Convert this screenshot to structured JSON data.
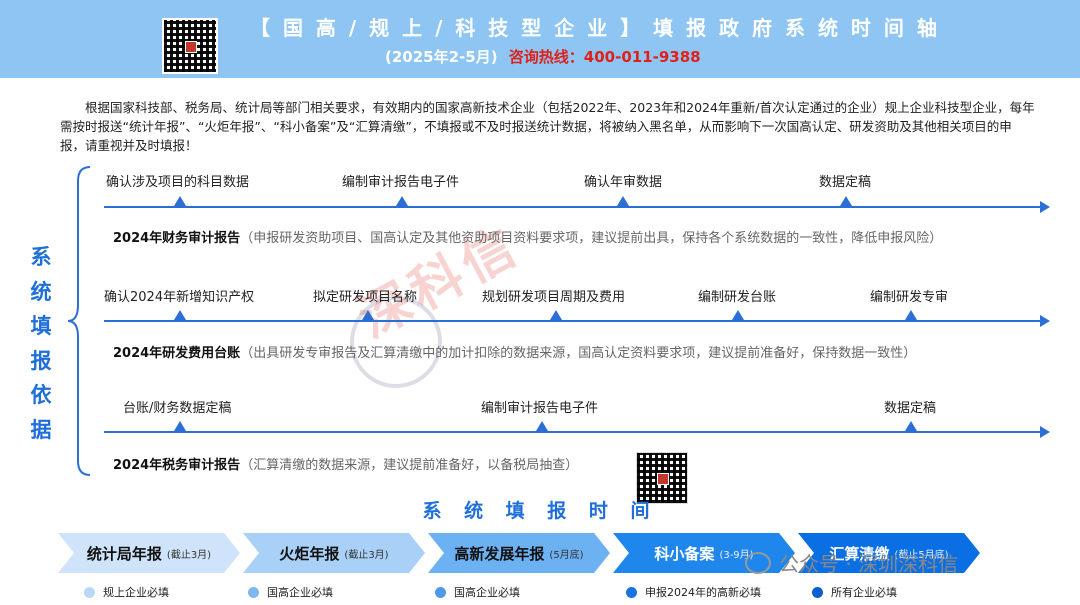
{
  "header": {
    "title": "【 国 高 / 规 上 / 科 技 型 企 业 】 填 报 政 府 系 统 时 间 轴",
    "date_range": "(2025年2-5月)",
    "hotline": "咨询热线：400-011-9388"
  },
  "intro": "根据国家科技部、税务局、统计局等部门相关要求，有效期内的国家高新技术企业（包括2022年、2023年和2024年重新/首次认定通过的企业）规上企业科技型企业，每年需按时报送“统计年报”、“火炬年报”、“科小备案”及“汇算清缴”，不填报或不及时报送统计数据，将被纳入黑名单，从而影响下一次国高认定、研发资助及其他相关项目的申报，请重视并及时填报！",
  "side_label": [
    "系",
    "统",
    "填",
    "报",
    "依",
    "据"
  ],
  "timelines": [
    {
      "milestones": [
        "确认涉及项目的科目数据",
        "编制审计报告电子件",
        "确认年审数据",
        "数据定稿"
      ],
      "report_title": "2024年财务审计报告",
      "report_note": "（申报研发资助项目、国高认定及其他资助项目资料要求项，建议提前出具，保持各个系统数据的一致性，降低申报风险）"
    },
    {
      "milestones": [
        "确认2024年新增知识产权",
        "拟定研发项目名称",
        "规划研发项目周期及费用",
        "编制研发台账",
        "编制研发专审"
      ],
      "report_title": "2024年研发费用台账",
      "report_note": "（出具研发专审报告及汇算清缴中的加计扣除的数据来源，国高认定资料要求项，建议提前准备好，保持数据一致性）"
    },
    {
      "milestones": [
        "台账/财务数据定稿",
        "编制审计报告电子件",
        "数据定稿"
      ],
      "report_title": "2024年税务审计报告",
      "report_note": "（汇算清缴的数据来源，建议提前准备好，以备税局抽查）"
    }
  ],
  "watermark": "深科信",
  "section_title": "系 统 填 报 时 间",
  "stages": [
    {
      "name": "统计局年报",
      "deadline": "(截止3月)",
      "color": "#cfe4fa",
      "who": "规上企业必填",
      "dot": "#b9d9f7"
    },
    {
      "name": "火炬年报",
      "deadline": "(截止3月)",
      "color": "#a9d0f7",
      "who": "国高企业必填",
      "dot": "#7fb8f0"
    },
    {
      "name": "高新发展年报",
      "deadline": "(5月底)",
      "color": "#6cb1f2",
      "who": "国高企业必填",
      "dot": "#4f9ae8"
    },
    {
      "name": "科小备案",
      "deadline": "(3-9月)",
      "color": "#1f86ec",
      "who": "申报2024年的高新必填",
      "dot": "#1a73e0"
    },
    {
      "name": "汇算清缴",
      "deadline": "(截止5月底)",
      "color": "#0a6fe3",
      "who": "所有企业必填",
      "dot": "#0a5fd0"
    }
  ],
  "wechat": "公众号 · 深圳深科信",
  "icons": {
    "qr": "qr-code-icon",
    "wechat": "wechat-icon"
  }
}
